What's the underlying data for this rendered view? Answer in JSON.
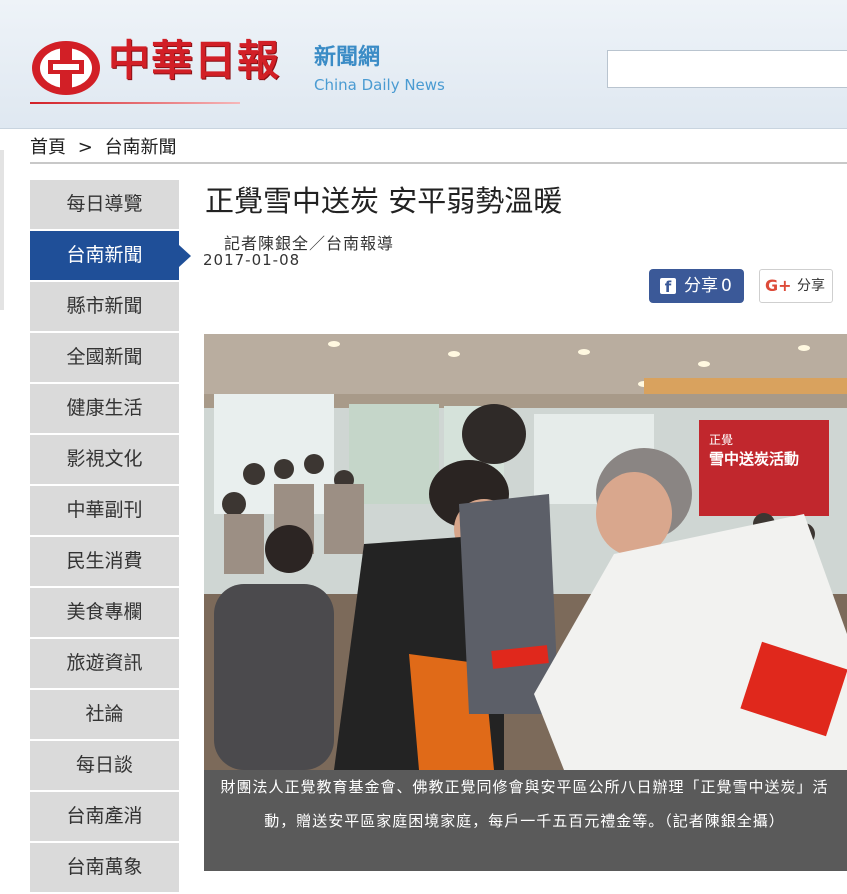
{
  "header": {
    "logo_cn": "中華日報",
    "logo_sub_cn": "新聞網",
    "logo_sub_en": "China Daily News",
    "search_value": ""
  },
  "breadcrumb": {
    "home": "首頁",
    "separator": ">",
    "current": "台南新聞"
  },
  "sidebar": {
    "items": [
      {
        "label": "每日導覽"
      },
      {
        "label": "台南新聞",
        "active": true
      },
      {
        "label": "縣市新聞"
      },
      {
        "label": "全國新聞"
      },
      {
        "label": "健康生活"
      },
      {
        "label": "影視文化"
      },
      {
        "label": "中華副刊"
      },
      {
        "label": "民生消費"
      },
      {
        "label": "美食專欄"
      },
      {
        "label": "旅遊資訊"
      },
      {
        "label": "社論"
      },
      {
        "label": "每日談"
      },
      {
        "label": "台南產消"
      },
      {
        "label": "台南萬象"
      }
    ]
  },
  "article": {
    "title": "正覺雪中送炭 安平弱勢溫暖",
    "byline": "記者陳銀全／台南報導",
    "date": "2017-01-08",
    "photo_banner": "正覺\n雪中送炭活動",
    "caption": "財團法人正覺教育基金會、佛教正覺同修會與安平區公所八日辦理「正覺雪中送炭」活動，贈送安平區家庭困境家庭，每戶一千五百元禮金等。（記者陳銀全攝）"
  },
  "share": {
    "facebook_label": "分享",
    "facebook_count": "0",
    "google_label": "分享",
    "google_icon_text": "G+"
  },
  "colors": {
    "brand_red": "#d21f26",
    "nav_active": "#1f4f98",
    "nav_bg": "#dadada",
    "facebook": "#3b5998"
  }
}
